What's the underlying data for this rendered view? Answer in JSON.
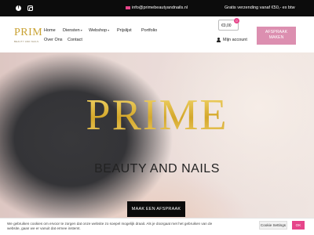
{
  "topbar": {
    "facebook_icon": "facebook-icon",
    "instagram_icon": "instagram-icon",
    "email": "info@primebeautyandnails.nl",
    "shipping_text": "Gratis verzending vanaf €50,- ex btw"
  },
  "logo": {
    "word": "PRIM",
    "tagline": "BEAUTY AND NAILS"
  },
  "nav": {
    "home": "Home",
    "diensten": "Diensten",
    "webshop": "Webshop",
    "prijslijst": "Prijslijst",
    "portfolio": "Portfolio",
    "over_ons": "Over Ons",
    "contact": "Contact"
  },
  "cart": {
    "amount": "€0,00",
    "count": "0"
  },
  "account": {
    "label": "Mijn account"
  },
  "header_cta": {
    "line1": "AFSPRAAK",
    "line2": "MAKEN"
  },
  "hero": {
    "title": "PRIME",
    "subtitle": "BEAUTY AND NAILS",
    "button": "MAAK EEN AFSPRAAK"
  },
  "cookie": {
    "text": "We gebruiken cookies om ervoor te zorgen dat onze website zo soepel mogelijk draait. Als je doorgaat met het gebruiken van de website, gaan we er vanuit dat ermee instemt.",
    "settings": "Cookie Settings",
    "ok": "OK"
  },
  "colors": {
    "accent_pink": "#e6458a",
    "cta_pink": "#dc8fb0",
    "gold": "#d4a72a",
    "topbar_bg": "#0c0c0c"
  }
}
